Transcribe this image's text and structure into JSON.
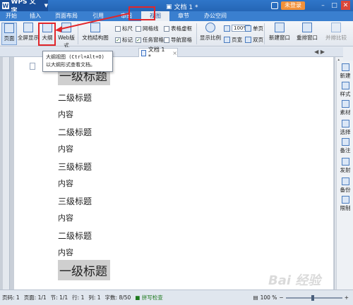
{
  "app": {
    "name": "WPS 文字",
    "doc_title": "文档 1 *",
    "login": "未登录"
  },
  "menu": {
    "tabs": [
      "开始",
      "插入",
      "页面布局",
      "引用",
      "审阅",
      "视图",
      "章节",
      "办公空间"
    ],
    "active": "视图"
  },
  "ribbon": {
    "page": "页面",
    "fullscreen": "全屏显示",
    "outline": "大纲",
    "web": "Web版式",
    "doc_structure": "文档结构图",
    "ruler": "标尺",
    "gridlines": "网格线",
    "table_virtual": "表格虚框",
    "marks": "标记",
    "task_pane": "任务窗格",
    "nav_pane": "导航窗格",
    "zoom_ratio": "显示比例",
    "zoom_value": "100%",
    "page_width": "页宽",
    "single_page": "单页",
    "double_page": "双页",
    "new_window": "新建窗口",
    "rearrange": "重排窗口",
    "side_by_side": "并排比较"
  },
  "tabstrip": {
    "doc_tab": "文档 1 *"
  },
  "tooltip": {
    "title": "大纲视图 (Ctrl+Alt+O)",
    "desc": "以大纲形式查看文档。"
  },
  "document": {
    "top_clip": "一级标题",
    "lines": [
      {
        "text": "二级标题",
        "style": "h2"
      },
      {
        "text": "内容",
        "style": "body"
      },
      {
        "text": "二级标题",
        "style": "h2"
      },
      {
        "text": "内容",
        "style": "body"
      },
      {
        "text": "三级标题",
        "style": "h2"
      },
      {
        "text": "内容",
        "style": "body"
      },
      {
        "text": "三级标题",
        "style": "h2"
      },
      {
        "text": "内容",
        "style": "body"
      },
      {
        "text": "二级标题",
        "style": "h2"
      },
      {
        "text": "内容",
        "style": "body"
      },
      {
        "text": "一级标题",
        "style": "h1"
      }
    ]
  },
  "sidepanel": [
    "新建",
    "样式",
    "素材",
    "选择",
    "备注",
    "发射",
    "备份",
    "限制"
  ],
  "status": {
    "page_code": "页码: 1",
    "pages": "页面: 1/1",
    "section": "节: 1/1",
    "row": "行: 1",
    "col": "列: 1",
    "words": "字数: 8/50",
    "spellcheck": "拼写检查",
    "zoom": "100 %"
  },
  "watermark": "Bai 经验",
  "colors": {
    "title_bar": "#2566b5",
    "highlight_box": "#e2262a",
    "login": "#f2913a"
  }
}
